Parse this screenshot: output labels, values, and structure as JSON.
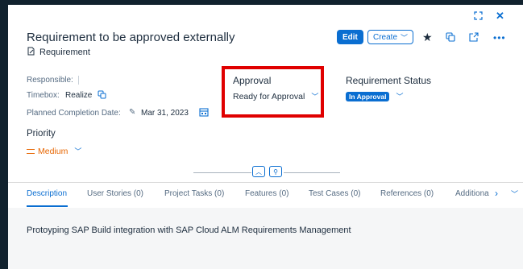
{
  "header": {
    "title": "Requirement to be approved externally",
    "object_type": "Requirement",
    "edit_label": "Edit",
    "create_label": "Create"
  },
  "fields": {
    "responsible_label": "Responsible:",
    "timebox_label": "Timebox:",
    "timebox_value": "Realize",
    "planned_label": "Planned Completion Date:",
    "planned_value": "Mar 31, 2023"
  },
  "approval": {
    "label": "Approval",
    "value": "Ready for Approval"
  },
  "req_status": {
    "label": "Requirement Status",
    "value": "In Approval"
  },
  "priority": {
    "label": "Priority",
    "value": "Medium"
  },
  "tabs": [
    {
      "label": "Description"
    },
    {
      "label": "User Stories (0)"
    },
    {
      "label": "Project Tasks (0)"
    },
    {
      "label": "Features (0)"
    },
    {
      "label": "Test Cases (0)"
    },
    {
      "label": "References (0)"
    },
    {
      "label": "Additiona"
    }
  ],
  "content": {
    "description": "Protoyping SAP Build integration with SAP Cloud ALM Requirements Management"
  },
  "colors": {
    "accent": "#0a6ed1",
    "priority": "#e76500",
    "highlight": "#e00000",
    "frame": "#11222e"
  },
  "icons": [
    "fullscreen-icon",
    "close-icon",
    "requirement-icon",
    "chevron-down-icon",
    "star-icon",
    "copy-icon",
    "share-icon",
    "more-icon",
    "calendar-icon",
    "edit-pencil-icon",
    "collapse-icon",
    "pin-icon",
    "chevron-right-icon"
  ]
}
